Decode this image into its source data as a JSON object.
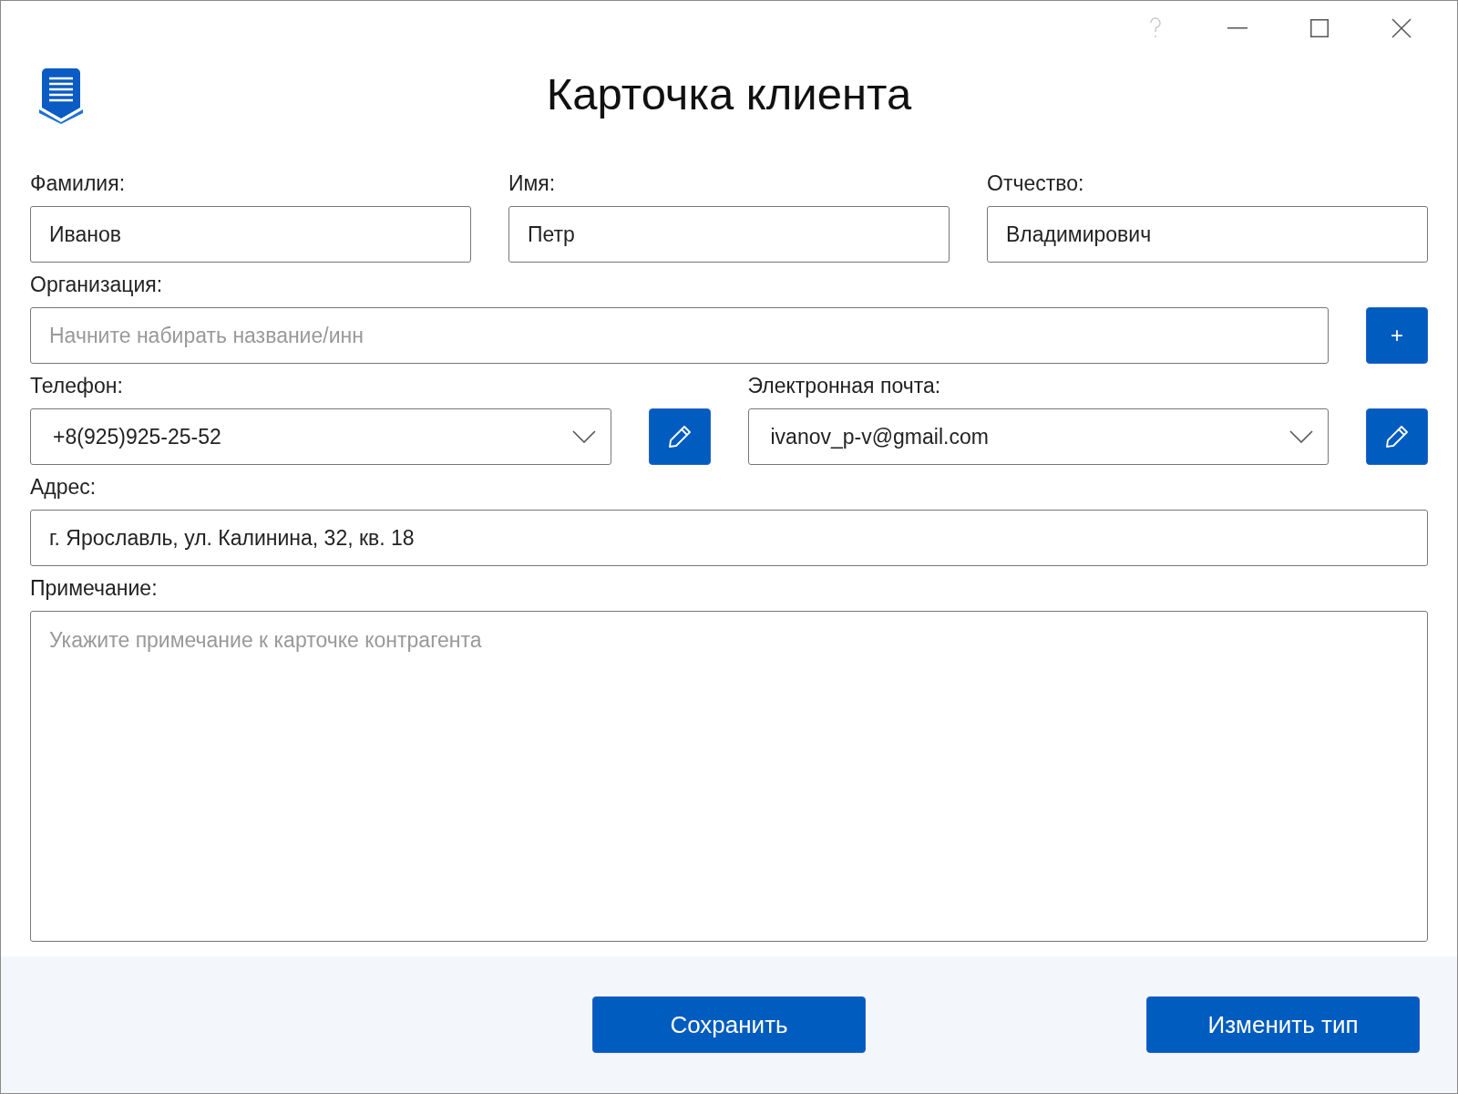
{
  "window": {
    "help_button": {
      "disabled": true
    }
  },
  "title": "Карточка клиента",
  "rows": [
    {
      "groups": [
        {
          "label": "Фамилия:",
          "kind": "text",
          "value": "Иванов"
        },
        {
          "label": "Имя:",
          "kind": "text",
          "value": "Петр"
        },
        {
          "label": "Отчество:",
          "kind": "text",
          "value": "Владимирович"
        }
      ]
    },
    {
      "groups": [
        {
          "label": "Организация:",
          "kind": "text",
          "placeholder": "Начните набирать название/инн",
          "button": {
            "kind": "text",
            "text": "+"
          }
        }
      ]
    },
    {
      "groups": [
        {
          "label": "Телефон:",
          "kind": "dropdown",
          "value": "+8(925)925-25-52",
          "button": {
            "kind": "edit"
          }
        },
        {
          "label": "Электронная почта:",
          "kind": "dropdown",
          "value": "ivanov_p-v@gmail.com",
          "button": {
            "kind": "edit"
          }
        }
      ]
    },
    {
      "groups": [
        {
          "label": "Адрес:",
          "kind": "text",
          "value": "г. Ярославль, ул. Калинина, 32, кв. 18"
        }
      ]
    },
    {
      "groups": [
        {
          "label": "Примечание:",
          "kind": "textarea",
          "placeholder": "Укажите примечание к карточке контрагента"
        }
      ]
    }
  ],
  "footer_buttons": [
    "Сохранить",
    "Изменить тип"
  ]
}
